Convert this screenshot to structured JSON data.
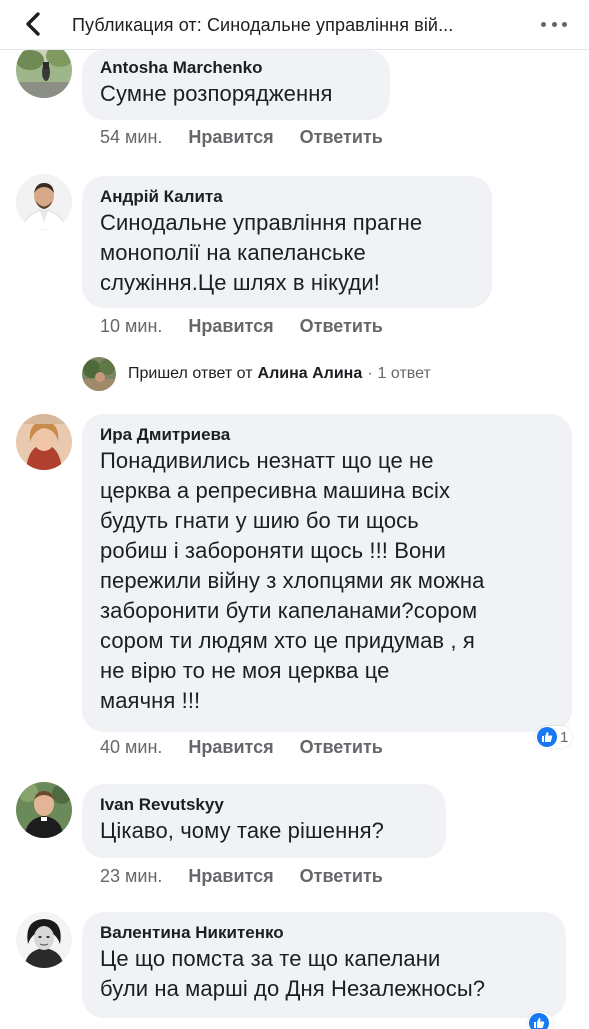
{
  "header": {
    "title": "Публикация от: Синодальне управління вій..."
  },
  "comments": [
    {
      "author": "Antosha Marchenko",
      "text": "Сумне розпорядження",
      "time": "54 мин.",
      "like_label": "Нравится",
      "reply_label": "Ответить"
    },
    {
      "author": "Андрій Калита",
      "text": "Синодальне управління прагне\nмонополії на капеланське\nслужіння.Це шлях в нікуди!",
      "time": "10 мин.",
      "like_label": "Нравится",
      "reply_label": "Ответить"
    },
    {
      "author": "Ира Дмитриева",
      "text": "Понадивились незнатт що це не\nцерква а репресивна машина всіх\nбудуть гнати у шию бо ти щось\nробиш і забороняти щось !!! Вони\nпережили війну з хлопцями як можна\nзаборонити бути капеланами?сором\nсором ти людям хто це придумав , я\nне вірю то не моя церква це\nмаячня !!!",
      "time": "40 мин.",
      "like_label": "Нравится",
      "reply_label": "Ответить",
      "reaction_count": "1"
    },
    {
      "author": "Ivan Revutskyy",
      "text": "Цікаво, чому таке рішення?",
      "time": "23 мин.",
      "like_label": "Нравится",
      "reply_label": "Ответить"
    },
    {
      "author": "Валентина Никитенко",
      "text": "Це що помста за те що капелани\nбули на марші до Дня Незалежносы?"
    }
  ],
  "reply_summary": {
    "prefix": "Пришел ответ от",
    "name": "Алина Алина",
    "separator": "·",
    "count": "1 ответ"
  },
  "colors": {
    "bubble": "#f0f2f5",
    "meta_text": "#65676b",
    "like_blue": "#1877f2"
  }
}
